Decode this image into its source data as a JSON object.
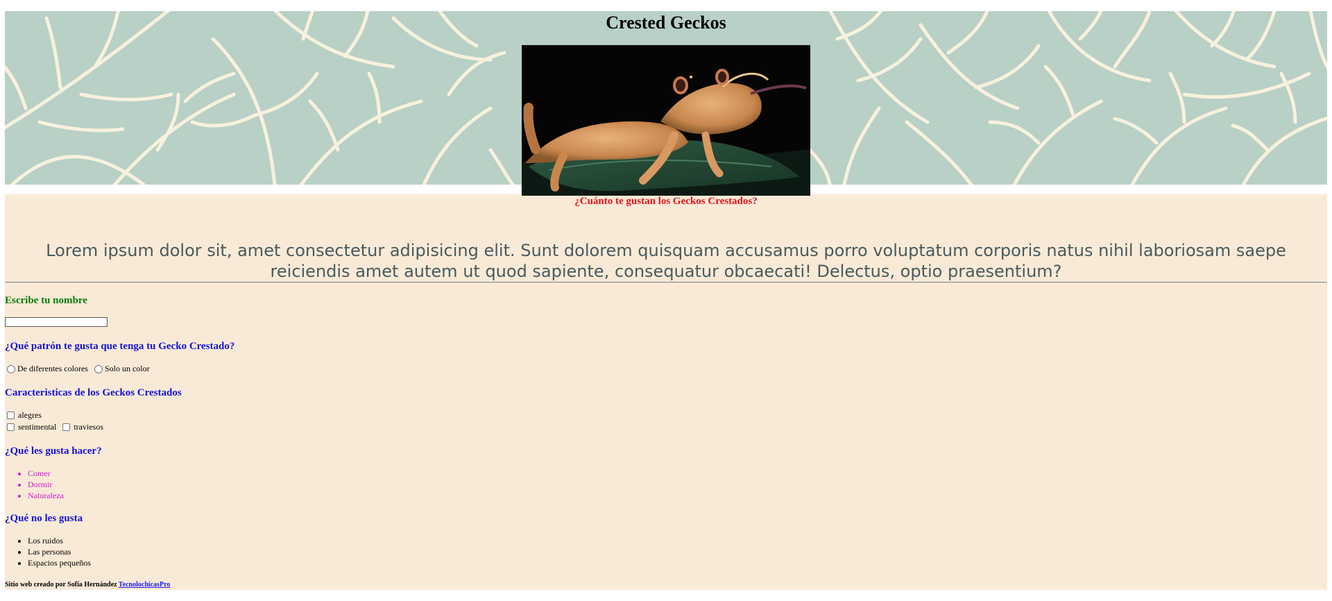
{
  "header": {
    "title": "Crested Geckos",
    "pattern_bg": "#b8d0c6",
    "pattern_line": "#f7f1dd"
  },
  "hero": {
    "image": "crested-gecko-photo",
    "caption": "¿Cuánto te gustan los Geckos Crestados?"
  },
  "intro": {
    "text": "Lorem ipsum dolor sit, amet consectetur adipisicing elit. Sunt dolorem quisquam accusamus porro voluptatum corporis natus nihil laboriosam saepe reiciendis amet autem ut quod sapiente, consequatur obcaecati! Delectus, optio praesentium?"
  },
  "form": {
    "name_heading": "Escribe tu nombre",
    "name_value": "",
    "pattern_heading": "¿Qué patrón te gusta que tenga tu Gecko Crestado?",
    "pattern_options": [
      "De diferentes colores",
      "Solo un color"
    ],
    "traits_heading": "Caracteristicas de los Geckos Crestados",
    "traits": [
      "alegres",
      "sentimental",
      "traviesos"
    ]
  },
  "likes": {
    "heading": "¿Qué les gusta hacer?",
    "items": [
      "Comer",
      "Dormir",
      "Naturaleza"
    ]
  },
  "dislikes": {
    "heading": "¿Qué no les gusta",
    "items": [
      "Los ruidos",
      "Las personas",
      "Espacios pequeños"
    ]
  },
  "footer": {
    "text": "Sitio web creado por Sofía Hernández",
    "link": "TecnolochicasPro"
  },
  "colors": {
    "page_bg": "#f9ead7",
    "caption": "#e3121b",
    "green_heading": "#0a7d0a",
    "blue_heading": "#1212d9",
    "likes_items": "#d11ad1",
    "intro_text": "#485b5e"
  }
}
